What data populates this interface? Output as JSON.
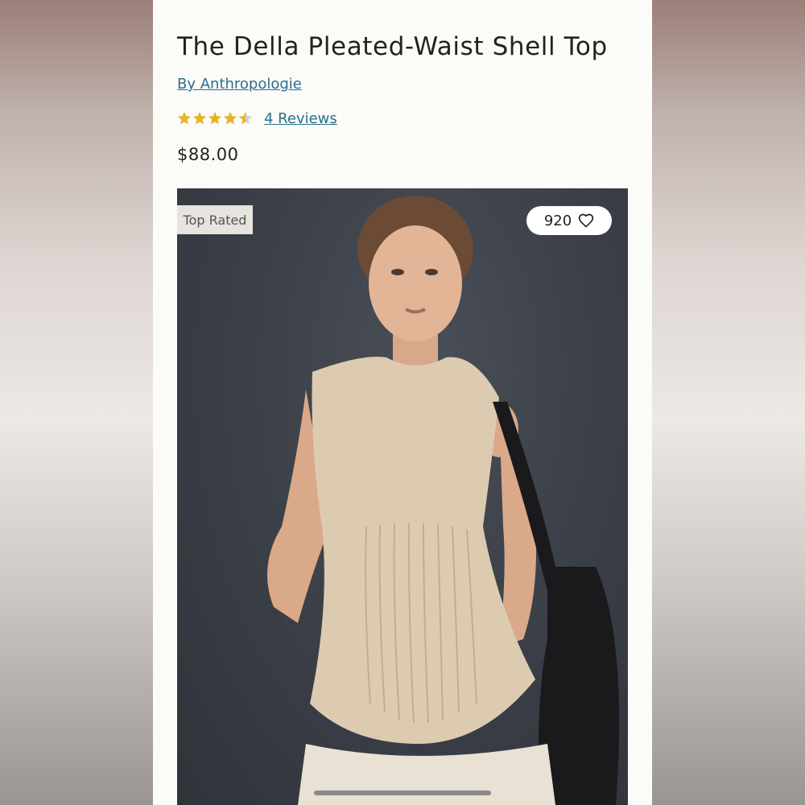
{
  "product": {
    "title": "The Della Pleated-Waist Shell Top",
    "brand": "By Anthropologie",
    "rating": 4.5,
    "rating_max": 5,
    "reviews_label": "4 Reviews",
    "price": "$88.00"
  },
  "image": {
    "badge": "Top Rated",
    "favorites_count": "920",
    "favorite_icon": "heart-outline-icon",
    "alt": "Model wearing a beige sleeveless pleated-waist shell top with a black leather tote bag"
  },
  "colors": {
    "link": "#2a6f91",
    "star": "#e6b422",
    "image_background": "#3a3e46",
    "top_fabric": "#dccbb0"
  }
}
